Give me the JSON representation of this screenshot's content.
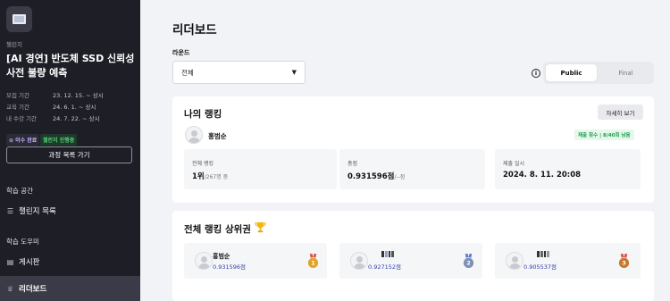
{
  "sidebar": {
    "crumb": "챌린지",
    "course_title": "[AI 경연] 반도체 SSD 신뢰성 사전 불량 예측",
    "periods": [
      {
        "label": "모집 기간",
        "value": "23. 12. 15. ~ 상시"
      },
      {
        "label": "교육 기간",
        "value": "24. 6. 1. ~ 상시"
      },
      {
        "label": "내 수강 기간",
        "value": "24. 7. 22. ~ 상시"
      }
    ],
    "badges": {
      "done": "이수 완료",
      "progress": "챌린지 진행중"
    },
    "course_list_button": "과정 목록 가기",
    "sections": {
      "learning": "학습 공간",
      "tools": "학습 도우미"
    },
    "nav": {
      "challenge_list": "챌린지 목록",
      "board": "게시판",
      "leaderboard": "리더보드"
    }
  },
  "main": {
    "title": "리더보드",
    "round_label": "라운드",
    "round_value": "전체",
    "toggle": {
      "public": "Public",
      "final": "Final",
      "selected": "Public"
    }
  },
  "my_rank": {
    "title": "나의 랭킹",
    "detail_button": "자세히 보기",
    "user": "홍범순",
    "submission_badge": "제출 횟수 | 8/40회 남음",
    "stats": {
      "rank_label": "전체 랭킹",
      "rank_value": "1위",
      "rank_total": "/267명 중",
      "score_label": "총점",
      "score_value": "0.931596점",
      "score_extra": "/--점",
      "date_label": "제출 일시",
      "date_value": "2024. 8. 11. 20:08"
    }
  },
  "top_rank": {
    "title": "전체 랭킹 상위권",
    "entries": [
      {
        "name": "홍범순",
        "score": "0.931596점",
        "medal": "1",
        "medal_color": "#e0a526"
      },
      {
        "name": "",
        "score": "0.927152점",
        "medal": "2",
        "medal_color": "#7f8fb5"
      },
      {
        "name": "",
        "score": "0.905537점",
        "medal": "3",
        "medal_color": "#c8772f"
      }
    ]
  },
  "colors": {
    "sidebar_bg": "#1d1e26",
    "accent_score": "#2f3fa8",
    "success": "#1e9e4f"
  }
}
